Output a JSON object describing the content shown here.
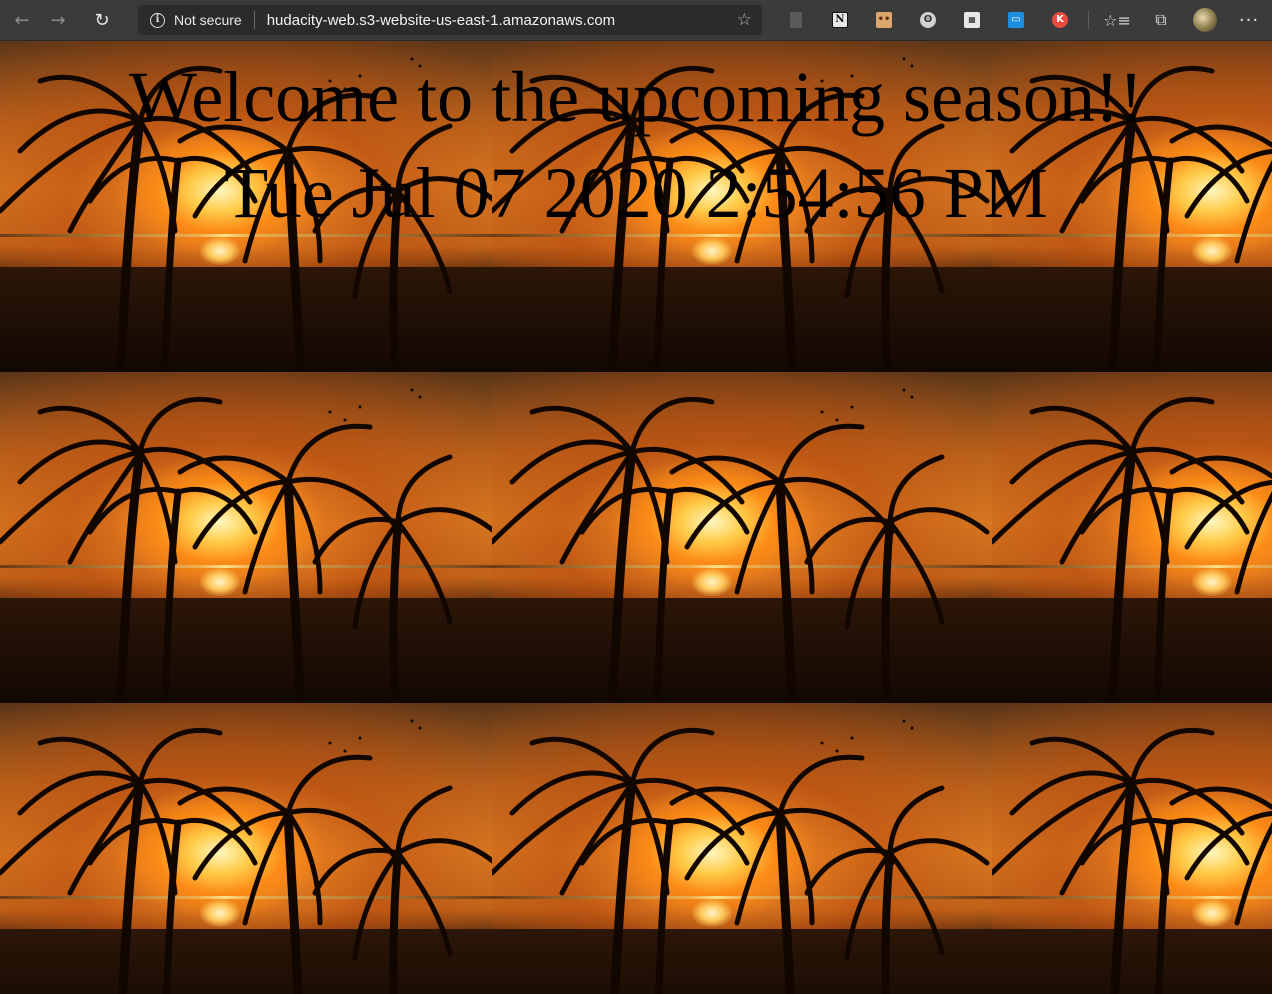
{
  "browser": {
    "security_label": "Not secure",
    "url": "hudacity-web.s3-website-us-east-1.amazonaws.com",
    "nav": {
      "back_icon": "←",
      "forward_icon": "→",
      "reload_icon": "↻"
    },
    "star_icon": "☆",
    "extensions": [
      {
        "name": "office-extension-icon",
        "glyph": "▯"
      },
      {
        "name": "notion-extension-icon",
        "glyph": "N"
      },
      {
        "name": "face-extension-icon",
        "glyph": "••"
      },
      {
        "name": "ghost-extension-icon",
        "glyph": "ʘ"
      },
      {
        "name": "qr-extension-icon",
        "glyph": "▦"
      },
      {
        "name": "blue-extension-icon",
        "glyph": "▭"
      },
      {
        "name": "k-extension-icon",
        "glyph": "K"
      }
    ],
    "favorites_icon": "☆≡",
    "collections_icon": "⧉",
    "more_icon": "···"
  },
  "page": {
    "heading": "Welcome to the upcoming season!!",
    "datetime": "Tue Jul 07 2020 2:54:56 PM"
  },
  "colors": {
    "toolbar_bg": "#3b3b3b",
    "address_bg": "#2b2b2b",
    "text_black": "#000000"
  }
}
